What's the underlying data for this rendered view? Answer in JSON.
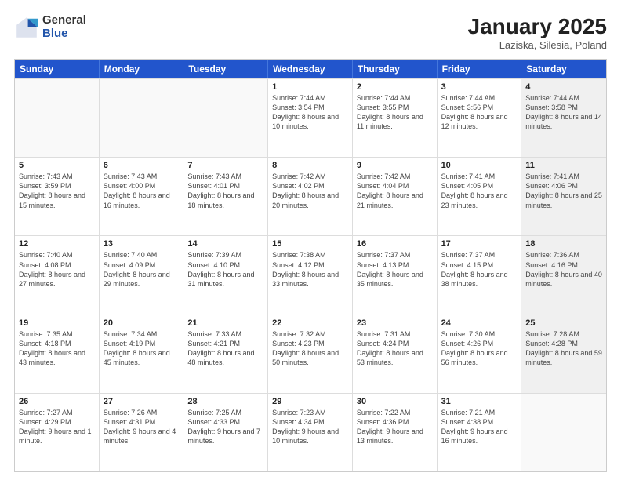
{
  "header": {
    "logo_general": "General",
    "logo_blue": "Blue",
    "month_title": "January 2025",
    "location": "Laziska, Silesia, Poland"
  },
  "weekdays": [
    "Sunday",
    "Monday",
    "Tuesday",
    "Wednesday",
    "Thursday",
    "Friday",
    "Saturday"
  ],
  "rows": [
    [
      {
        "day": "",
        "text": "",
        "shaded": false,
        "empty": true
      },
      {
        "day": "",
        "text": "",
        "shaded": false,
        "empty": true
      },
      {
        "day": "",
        "text": "",
        "shaded": false,
        "empty": true
      },
      {
        "day": "1",
        "text": "Sunrise: 7:44 AM\nSunset: 3:54 PM\nDaylight: 8 hours and 10 minutes.",
        "shaded": false,
        "empty": false
      },
      {
        "day": "2",
        "text": "Sunrise: 7:44 AM\nSunset: 3:55 PM\nDaylight: 8 hours and 11 minutes.",
        "shaded": false,
        "empty": false
      },
      {
        "day": "3",
        "text": "Sunrise: 7:44 AM\nSunset: 3:56 PM\nDaylight: 8 hours and 12 minutes.",
        "shaded": false,
        "empty": false
      },
      {
        "day": "4",
        "text": "Sunrise: 7:44 AM\nSunset: 3:58 PM\nDaylight: 8 hours and 14 minutes.",
        "shaded": true,
        "empty": false
      }
    ],
    [
      {
        "day": "5",
        "text": "Sunrise: 7:43 AM\nSunset: 3:59 PM\nDaylight: 8 hours and 15 minutes.",
        "shaded": false,
        "empty": false
      },
      {
        "day": "6",
        "text": "Sunrise: 7:43 AM\nSunset: 4:00 PM\nDaylight: 8 hours and 16 minutes.",
        "shaded": false,
        "empty": false
      },
      {
        "day": "7",
        "text": "Sunrise: 7:43 AM\nSunset: 4:01 PM\nDaylight: 8 hours and 18 minutes.",
        "shaded": false,
        "empty": false
      },
      {
        "day": "8",
        "text": "Sunrise: 7:42 AM\nSunset: 4:02 PM\nDaylight: 8 hours and 20 minutes.",
        "shaded": false,
        "empty": false
      },
      {
        "day": "9",
        "text": "Sunrise: 7:42 AM\nSunset: 4:04 PM\nDaylight: 8 hours and 21 minutes.",
        "shaded": false,
        "empty": false
      },
      {
        "day": "10",
        "text": "Sunrise: 7:41 AM\nSunset: 4:05 PM\nDaylight: 8 hours and 23 minutes.",
        "shaded": false,
        "empty": false
      },
      {
        "day": "11",
        "text": "Sunrise: 7:41 AM\nSunset: 4:06 PM\nDaylight: 8 hours and 25 minutes.",
        "shaded": true,
        "empty": false
      }
    ],
    [
      {
        "day": "12",
        "text": "Sunrise: 7:40 AM\nSunset: 4:08 PM\nDaylight: 8 hours and 27 minutes.",
        "shaded": false,
        "empty": false
      },
      {
        "day": "13",
        "text": "Sunrise: 7:40 AM\nSunset: 4:09 PM\nDaylight: 8 hours and 29 minutes.",
        "shaded": false,
        "empty": false
      },
      {
        "day": "14",
        "text": "Sunrise: 7:39 AM\nSunset: 4:10 PM\nDaylight: 8 hours and 31 minutes.",
        "shaded": false,
        "empty": false
      },
      {
        "day": "15",
        "text": "Sunrise: 7:38 AM\nSunset: 4:12 PM\nDaylight: 8 hours and 33 minutes.",
        "shaded": false,
        "empty": false
      },
      {
        "day": "16",
        "text": "Sunrise: 7:37 AM\nSunset: 4:13 PM\nDaylight: 8 hours and 35 minutes.",
        "shaded": false,
        "empty": false
      },
      {
        "day": "17",
        "text": "Sunrise: 7:37 AM\nSunset: 4:15 PM\nDaylight: 8 hours and 38 minutes.",
        "shaded": false,
        "empty": false
      },
      {
        "day": "18",
        "text": "Sunrise: 7:36 AM\nSunset: 4:16 PM\nDaylight: 8 hours and 40 minutes.",
        "shaded": true,
        "empty": false
      }
    ],
    [
      {
        "day": "19",
        "text": "Sunrise: 7:35 AM\nSunset: 4:18 PM\nDaylight: 8 hours and 43 minutes.",
        "shaded": false,
        "empty": false
      },
      {
        "day": "20",
        "text": "Sunrise: 7:34 AM\nSunset: 4:19 PM\nDaylight: 8 hours and 45 minutes.",
        "shaded": false,
        "empty": false
      },
      {
        "day": "21",
        "text": "Sunrise: 7:33 AM\nSunset: 4:21 PM\nDaylight: 8 hours and 48 minutes.",
        "shaded": false,
        "empty": false
      },
      {
        "day": "22",
        "text": "Sunrise: 7:32 AM\nSunset: 4:23 PM\nDaylight: 8 hours and 50 minutes.",
        "shaded": false,
        "empty": false
      },
      {
        "day": "23",
        "text": "Sunrise: 7:31 AM\nSunset: 4:24 PM\nDaylight: 8 hours and 53 minutes.",
        "shaded": false,
        "empty": false
      },
      {
        "day": "24",
        "text": "Sunrise: 7:30 AM\nSunset: 4:26 PM\nDaylight: 8 hours and 56 minutes.",
        "shaded": false,
        "empty": false
      },
      {
        "day": "25",
        "text": "Sunrise: 7:28 AM\nSunset: 4:28 PM\nDaylight: 8 hours and 59 minutes.",
        "shaded": true,
        "empty": false
      }
    ],
    [
      {
        "day": "26",
        "text": "Sunrise: 7:27 AM\nSunset: 4:29 PM\nDaylight: 9 hours and 1 minute.",
        "shaded": false,
        "empty": false
      },
      {
        "day": "27",
        "text": "Sunrise: 7:26 AM\nSunset: 4:31 PM\nDaylight: 9 hours and 4 minutes.",
        "shaded": false,
        "empty": false
      },
      {
        "day": "28",
        "text": "Sunrise: 7:25 AM\nSunset: 4:33 PM\nDaylight: 9 hours and 7 minutes.",
        "shaded": false,
        "empty": false
      },
      {
        "day": "29",
        "text": "Sunrise: 7:23 AM\nSunset: 4:34 PM\nDaylight: 9 hours and 10 minutes.",
        "shaded": false,
        "empty": false
      },
      {
        "day": "30",
        "text": "Sunrise: 7:22 AM\nSunset: 4:36 PM\nDaylight: 9 hours and 13 minutes.",
        "shaded": false,
        "empty": false
      },
      {
        "day": "31",
        "text": "Sunrise: 7:21 AM\nSunset: 4:38 PM\nDaylight: 9 hours and 16 minutes.",
        "shaded": false,
        "empty": false
      },
      {
        "day": "",
        "text": "",
        "shaded": true,
        "empty": true
      }
    ]
  ]
}
